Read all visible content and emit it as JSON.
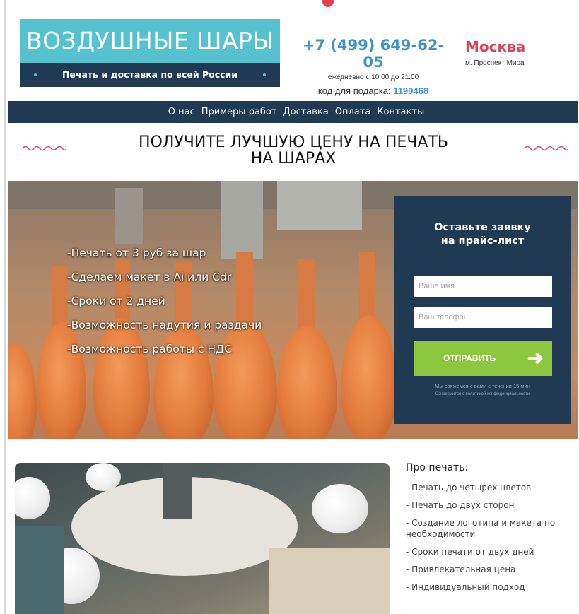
{
  "header": {
    "logo_title": "ВОЗДУШНЫЕ ШАРЫ",
    "logo_tagline": "Печать и доставка по всей России",
    "phone": "+7 (499) 649-62-05",
    "hours": "ежедневно с 10:00 до 21:00",
    "gift_label": "код для подарка:",
    "gift_code": "1190468",
    "city": "Москва",
    "metro": "м. Проспект Мира"
  },
  "nav": {
    "items": [
      {
        "label": "О нас"
      },
      {
        "label": "Примеры работ"
      },
      {
        "label": "Доставка"
      },
      {
        "label": "Оплата"
      },
      {
        "label": "Контакты"
      }
    ]
  },
  "headline": {
    "line1": "ПОЛУЧИТЕ ЛУЧШУЮ ЦЕНУ НА ПЕЧАТЬ",
    "line2": "НА ШАРАХ"
  },
  "hero": {
    "benefits": [
      "-Печать от 3 руб за шар",
      "-Сделаем макет в Ai или Cdr",
      "-Сроки от 2 дней",
      "-Возможность надутия и раздачи",
      "-Возможность работы с НДС"
    ]
  },
  "form": {
    "title_line1": "Оставьте заявку",
    "title_line2": "на прайс-лист",
    "name_placeholder": "Ваше имя",
    "phone_placeholder": "Ваш телефон",
    "submit_label": "ОТПРАВИТЬ",
    "submit_icon": "arrow-right-icon",
    "note": "Мы свяжемся с вами с течении 15 мин",
    "privacy": "Ознакомится с политикой конфиденциальности"
  },
  "about": {
    "title": "Про печать:",
    "items": [
      "- Печать до четырех цветов",
      "- Печать до двух сторон",
      "- Создание логотипа и макета по необходимости",
      "- Сроки печати от двух дней",
      "- Привлекательная цена",
      "- Индивидуальный подход"
    ]
  },
  "colors": {
    "navy": "#1f3a52",
    "teal": "#56c2cf",
    "phone_blue": "#3f93c6",
    "city_red": "#d94456",
    "submit_green": "#8dc63f"
  }
}
